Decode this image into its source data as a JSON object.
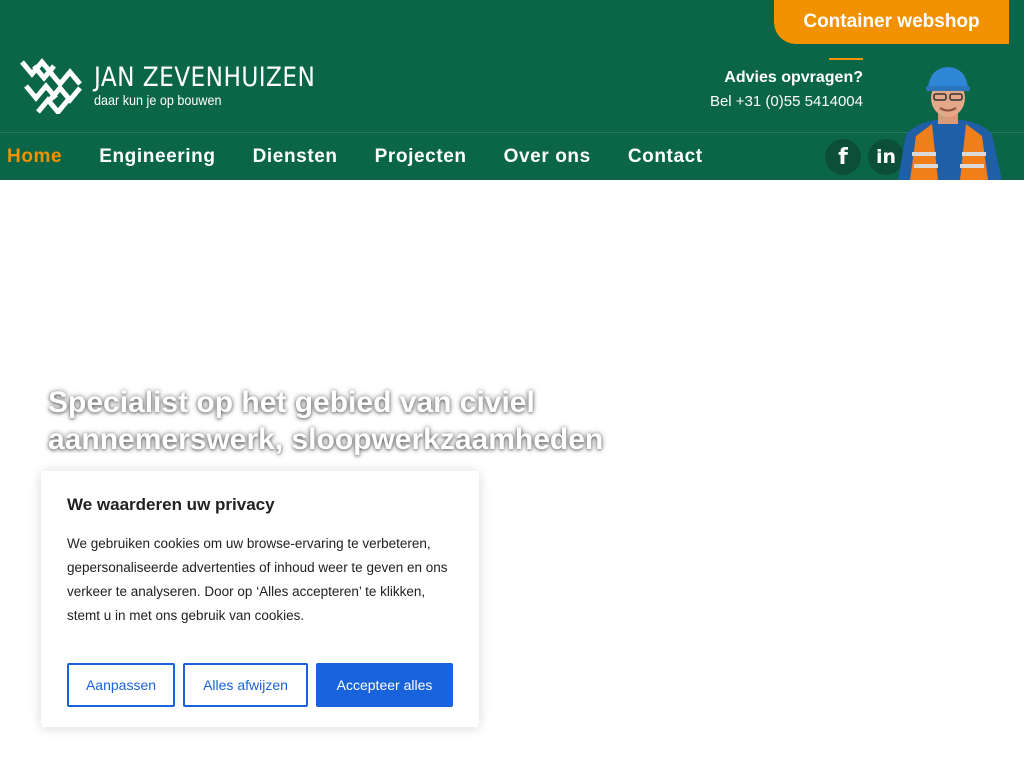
{
  "header": {
    "webshop_label": "Container webshop",
    "logo": {
      "name": "JAN ZEVENHUIZEN",
      "tagline": "daar kun je op bouwen"
    },
    "contact": {
      "advies": "Advies opvragen?",
      "phone": "Bel +31 (0)55 5414004"
    },
    "social": {
      "facebook": "f",
      "linkedin": "in"
    }
  },
  "nav": {
    "items": [
      "Home",
      "Engineering",
      "Diensten",
      "Projecten",
      "Over ons",
      "Contact"
    ],
    "active": "Home"
  },
  "hero": {
    "title_line1": "Specialist op het gebied van civiel",
    "title_line2": "aannemerswerk, sloopwerkzaamheden"
  },
  "cookie": {
    "title": "We waarderen uw privacy",
    "text": "We gebruiken cookies om uw browse-ervaring te verbeteren, gepersonaliseerde advertenties of inhoud weer te geven en ons verkeer te analyseren. Door op ‘Alles accepteren’ te klikken, stemt u in met ons gebruik van cookies.",
    "customize": "Aanpassen",
    "reject": "Alles afwijzen",
    "accept": "Accepteer alles"
  },
  "colors": {
    "brand_green": "#0a6647",
    "accent_orange": "#f39200",
    "cookie_blue": "#1863dc"
  },
  "icons": [
    "logo-mark-icon",
    "facebook-icon",
    "linkedin-icon"
  ]
}
